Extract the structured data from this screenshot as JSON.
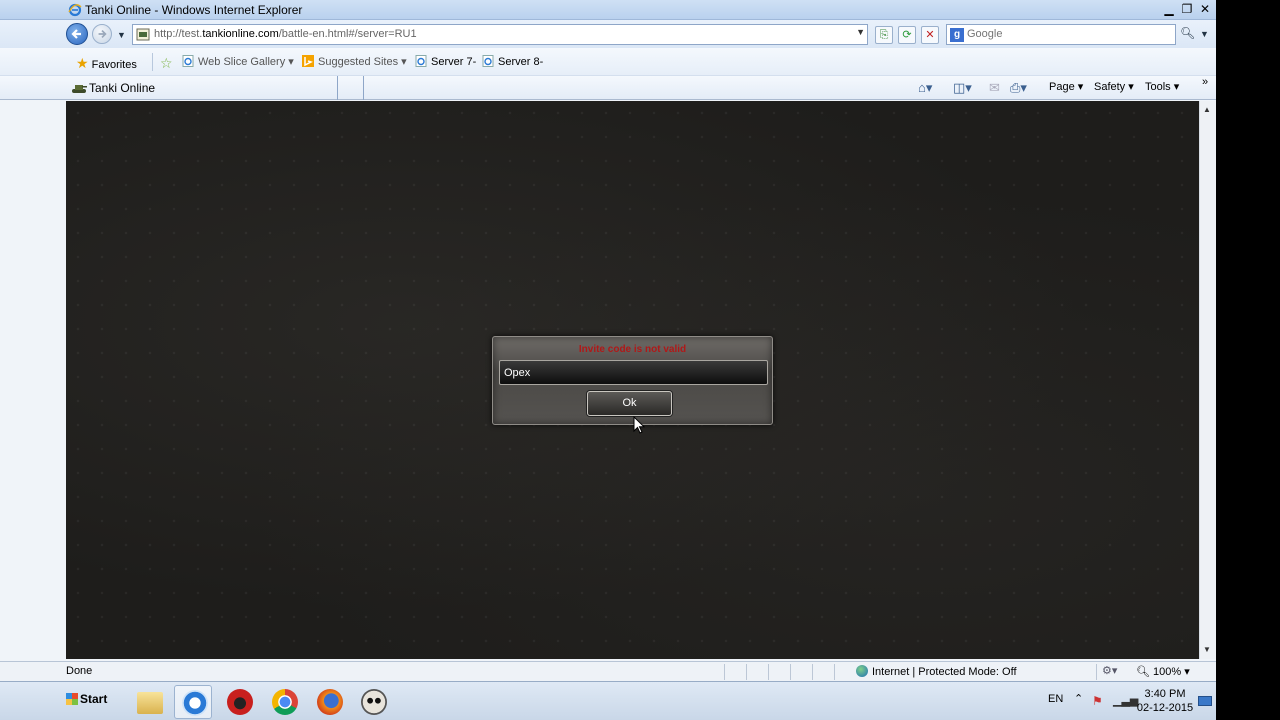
{
  "window": {
    "title": "Tanki Online - Windows Internet Explorer",
    "minimize": "▁",
    "maximize": "❐",
    "close": "✕"
  },
  "address_bar": {
    "url_prefix": "http://test.",
    "url_domain": "tankionline.com",
    "url_suffix": "/battle-en.html#/server=RU1"
  },
  "search": {
    "engine_letter": "g",
    "placeholder": "Google"
  },
  "favorites_bar": {
    "favorites_label": "Favorites",
    "items": [
      "Web Slice Gallery",
      "Suggested Sites",
      "Server 7-",
      "Server 8-"
    ]
  },
  "tab": {
    "label": "Tanki Online"
  },
  "command_bar": {
    "page_label": "Page",
    "safety_label": "Safety",
    "tools_label": "Tools",
    "chevron": "»"
  },
  "dialog": {
    "message": "Invite code is not valid",
    "input_value": "Opex",
    "ok_label": "Ok"
  },
  "status_bar": {
    "status": "Done",
    "zone": "Internet | Protected Mode: Off",
    "zoom": "100%"
  },
  "taskbar": {
    "start_label": "Start",
    "language": "EN",
    "time": "3:40 PM",
    "date": "02-12-2015"
  },
  "colors": {
    "error_text": "#b01818",
    "content_bg": "#1e1d1b"
  }
}
